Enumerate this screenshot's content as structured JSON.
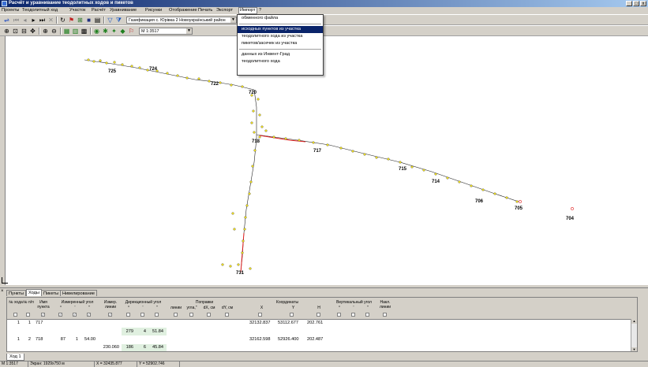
{
  "window": {
    "title": "Расчёт и уравнивание теодолитных ходов и пикетов",
    "controls": [
      "_",
      "□",
      "x"
    ]
  },
  "menu": [
    "Проекты",
    "Теодолитный ход",
    "Участок",
    "Расчёт",
    "Уравнивание",
    "Рисунки",
    "Отображение",
    "Печать",
    "Экспорт",
    "Импорт",
    "?"
  ],
  "import_menu": {
    "items": [
      "обменного файла",
      "исходных пунктов из участка",
      "теодолитного хода из участка",
      "пикетов/засечек из участка",
      "данных из Инвент-Град",
      "теодолитного хода"
    ],
    "selected_index": 1
  },
  "toolbar": {
    "project_combo": "Газификация с. Юрівка 2 Новоукраїнський район",
    "scale_label": "М 1:",
    "scale_value": "3517"
  },
  "map": {
    "station_labels": [
      "725",
      "724",
      "722",
      "720",
      "718",
      "717",
      "715",
      "714",
      "706",
      "705",
      "704",
      "731"
    ]
  },
  "panel": {
    "tabs": [
      "Пункты",
      "Ходы",
      "Пикеты",
      "Нивелирование"
    ],
    "active_tab": 1,
    "headers": {
      "hod_num": "№ хода",
      "point_num": "№ п/п",
      "point_name": "Имя пункта",
      "meas_angle": "Измеренный угол",
      "line_meas": "Измер. линии",
      "dir_angle": "Дирекционный угол",
      "corrections": "Поправки",
      "corr_line": "линии",
      "corr_angle": "угла,\"",
      "corr_dx": "dX, см",
      "corr_dy": "dY, см",
      "coords": "Координаты",
      "coord_x": "X",
      "coord_y": "Y",
      "coord_h": "H",
      "vert_angle": "Вертикальный угол",
      "incl_line": "Накл. линии",
      "deg": "°",
      "min": "'",
      "sec": "\""
    },
    "rows": [
      {
        "hod": "1",
        "n": "1",
        "name": "717",
        "x": "32132.837",
        "y": "53112.677",
        "h": "202.761",
        "dir_deg": "279",
        "dir_min": "4",
        "dir_sec": "51.84"
      },
      {
        "hod": "1",
        "n": "2",
        "name": "718",
        "ang_deg": "87",
        "ang_min": "1",
        "ang_sec": "54.00",
        "x": "32162.598",
        "y": "52926.400",
        "h": "202.487",
        "line": "230.060",
        "dir_deg": "186",
        "dir_min": "6",
        "dir_sec": "45.84"
      }
    ],
    "subtab": "Ход 1"
  },
  "status": {
    "scale": "М 1:3517",
    "area": "Экран: 1929x750 м",
    "x": "X = 32435.877",
    "y": "Y = 52902.746"
  },
  "colors": {
    "title_start": "#0a246a",
    "title_end": "#a6caf0",
    "menu_highlight": "#0a246a",
    "traverse_red": "#e02020",
    "point_yellow": "#f0e020"
  }
}
